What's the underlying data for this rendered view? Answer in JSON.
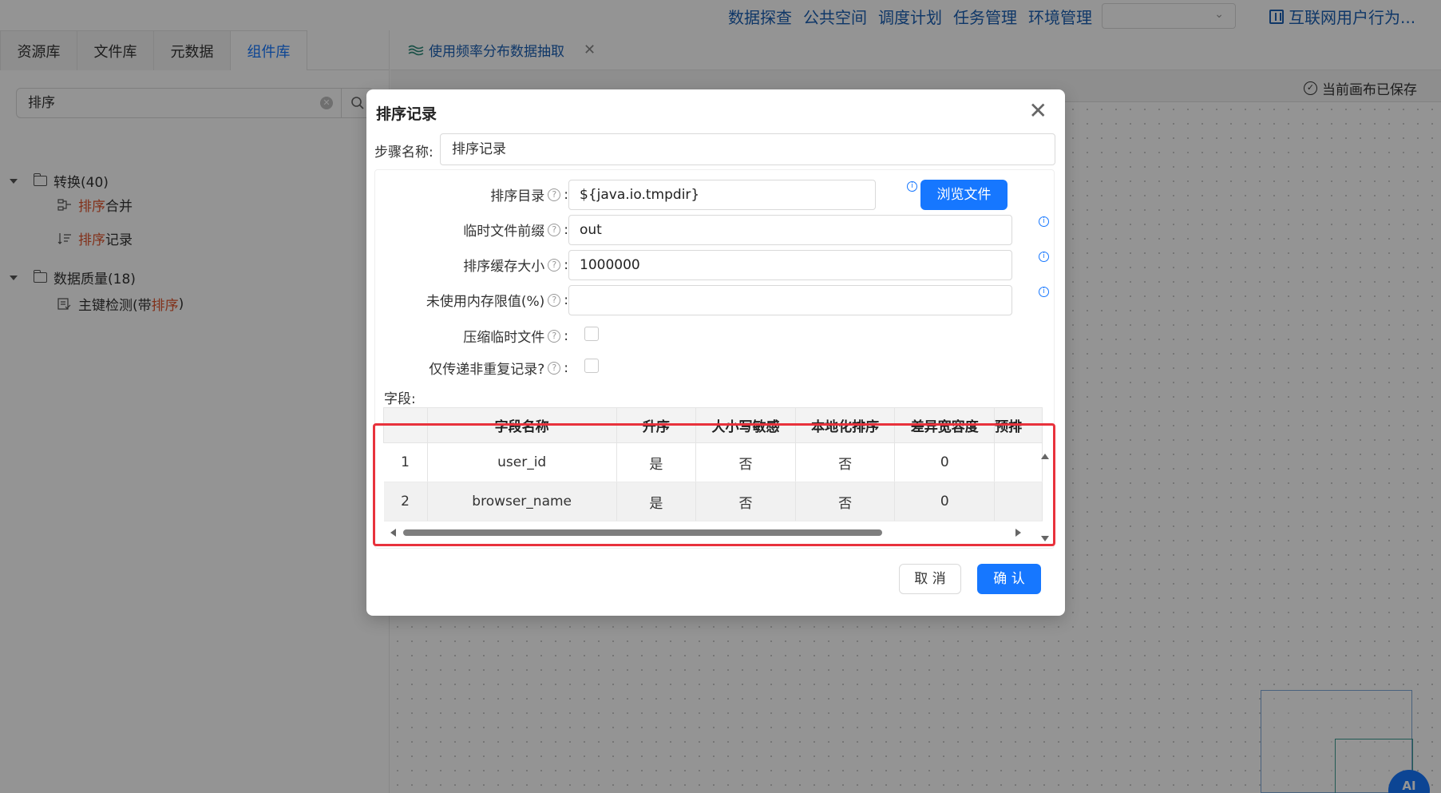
{
  "topnav": {
    "items": [
      "数据探查",
      "公共空间",
      "调度计划",
      "任务管理",
      "环境管理"
    ],
    "project": "互联网用户行为...",
    "select_value": ""
  },
  "left": {
    "tabs": [
      {
        "label": "资源库",
        "active": false
      },
      {
        "label": "文件库",
        "active": false
      },
      {
        "label": "元数据",
        "active": false
      },
      {
        "label": "组件库",
        "active": true
      }
    ],
    "search_value": "排序",
    "tree": {
      "group1": {
        "label": "转换(40)"
      },
      "g1_item1": {
        "hl": "排序",
        "rest": " 合并"
      },
      "g1_item2": {
        "hl": "排序",
        "rest": " 记录"
      },
      "group2": {
        "label": "数据质量(18)"
      },
      "g2_item1": {
        "pre": "主键检测(带 ",
        "hl": "排序",
        "post": " )"
      }
    }
  },
  "canvas": {
    "tab_title": "使用频率分布数据抽取",
    "saved_text": "当前画布已保存",
    "ai_label": "AI"
  },
  "modal": {
    "title": "排序记录",
    "step_name_label": "步骤名称:",
    "step_name_value": "排序记录",
    "sort_dir_label": "排序目录",
    "sort_dir_value": "${java.io.tmpdir}",
    "browse_label": "浏览文件",
    "prefix_label": "临时文件前缀",
    "prefix_value": "out",
    "cache_label": "排序缓存大小",
    "cache_value": "1000000",
    "mem_label": "未使用内存限值(%)",
    "mem_value": "",
    "compress_label": "压缩临时文件",
    "unique_label": "仅传递非重复记录?",
    "fields_label": "字段:",
    "columns": [
      "",
      "字段名称",
      "升序",
      "大小写敏感",
      "本地化排序",
      "差异宽容度",
      "预排"
    ],
    "rows": [
      [
        "1",
        "user_id",
        "是",
        "否",
        "否",
        "0",
        ""
      ],
      [
        "2",
        "browser_name",
        "是",
        "否",
        "否",
        "0",
        ""
      ]
    ],
    "scroll_thumb_fraction": 0.79,
    "cancel_label": "取 消",
    "ok_label": "确 认",
    "colors": {
      "primary": "#1677ff",
      "highlight_frame": "#e8323c"
    }
  }
}
